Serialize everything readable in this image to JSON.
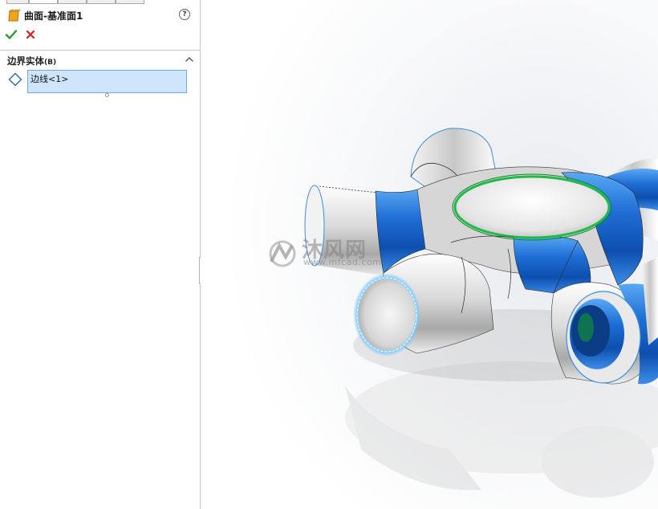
{
  "property_manager": {
    "feature_title": "曲面-基准面1",
    "help_glyph": "?",
    "ok_glyph": "✔",
    "cancel_glyph": "✕",
    "section": {
      "title": "边界实体",
      "shortcut": "(B)"
    },
    "selection_items": [
      "边线<1>"
    ]
  },
  "watermark": {
    "text": "沐风网",
    "url": "www.mfcad.com"
  },
  "colors": {
    "accent_blue": "#1e6fd8",
    "selection_fill": "#cfe5fb",
    "selection_border": "#74a9dd",
    "ok_green": "#2a9c2a",
    "cancel_red": "#d42020",
    "feature_icon_orange": "#f0a020",
    "edge_green": "#22b84a"
  },
  "icons": {
    "feature": "surface-plane-icon",
    "help": "help-icon",
    "ok": "checkmark-icon",
    "cancel": "close-icon",
    "collapse": "chevron-up-icon",
    "entity": "boundary-entity-icon"
  }
}
